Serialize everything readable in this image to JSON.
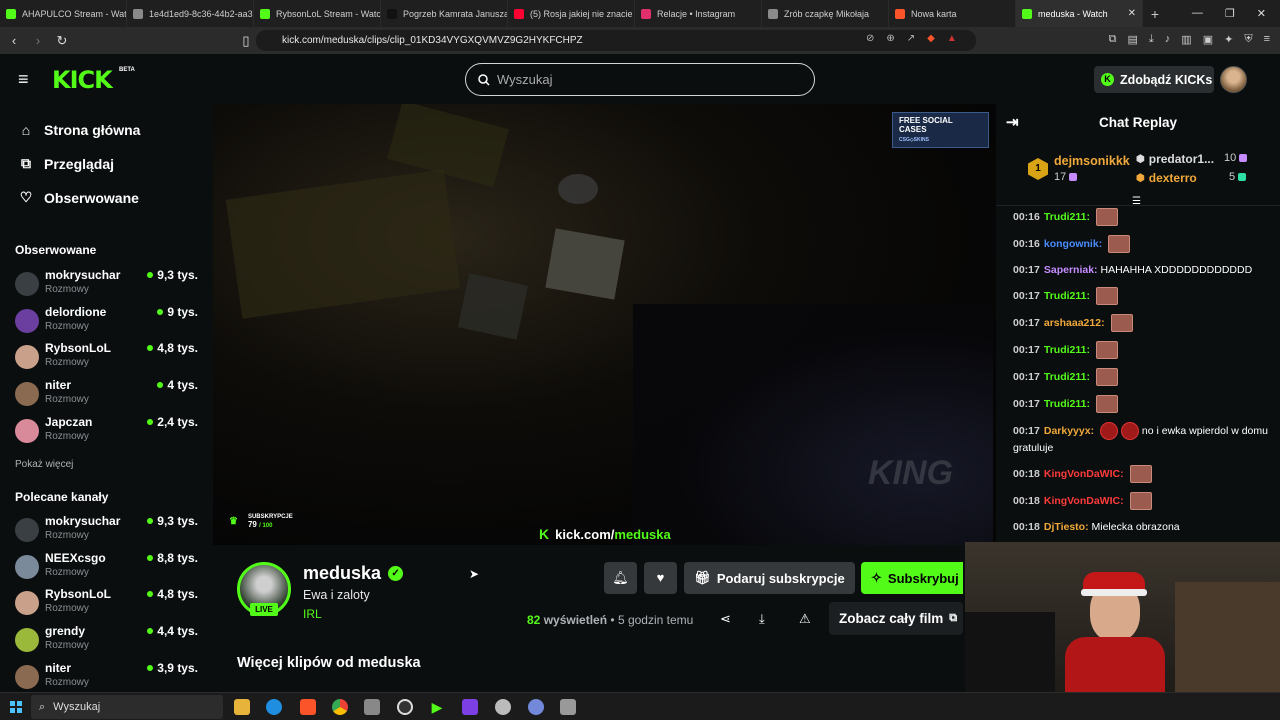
{
  "browser": {
    "tabs": [
      {
        "label": "AHAPULCO Stream - Watc",
        "color": "#53fc18"
      },
      {
        "label": "1e4d1ed9-8c36-44b2-aa3",
        "color": "#8a8a8a"
      },
      {
        "label": "RybsonLoL Stream - Watc",
        "color": "#53fc18"
      },
      {
        "label": "Pogrzeb Kamrata Janusza",
        "color": "#111111"
      },
      {
        "label": "(5) Rosja jakiej nie znacie",
        "color": "#ff0033"
      },
      {
        "label": "Relacje • Instagram",
        "color": "#e1306c"
      },
      {
        "label": "Zrób czapkę Mikołaja",
        "color": "#8a8a8a"
      },
      {
        "label": "Nowa karta",
        "color": "#fb542b"
      },
      {
        "label": "meduska - Watch",
        "color": "#53fc18",
        "active": true
      }
    ],
    "url": "kick.com/meduska/clips/clip_01KD34VYGXQVMVZ9G2HYKFCHPZ"
  },
  "header": {
    "logo": "KICK",
    "beta": "BETA",
    "search_placeholder": "Wyszukaj",
    "get_kicks": "Zdobądź KICKs"
  },
  "sidebar": {
    "nav": [
      {
        "label": "Strona główna",
        "icon": "home-icon"
      },
      {
        "label": "Przeglądaj",
        "icon": "browse-icon"
      },
      {
        "label": "Obserwowane",
        "icon": "heart-icon"
      }
    ],
    "followed_title": "Obserwowane",
    "followed": [
      {
        "name": "mokrysuchar",
        "category": "Rozmowy",
        "viewers": "9,3 tys.",
        "color": "#3a3f44"
      },
      {
        "name": "delordione",
        "category": "Rozmowy",
        "viewers": "9 tys.",
        "color": "#6b3fa0"
      },
      {
        "name": "RybsonLoL",
        "category": "Rozmowy",
        "viewers": "4,8 tys.",
        "color": "#c9a08a"
      },
      {
        "name": "niter",
        "category": "Rozmowy",
        "viewers": "4 tys.",
        "color": "#8a6a50"
      },
      {
        "name": "Japczan",
        "category": "Rozmowy",
        "viewers": "2,4 tys.",
        "color": "#d98a9a"
      }
    ],
    "show_more": "Pokaż więcej",
    "recommended_title": "Polecane kanały",
    "recommended": [
      {
        "name": "mokrysuchar",
        "category": "Rozmowy",
        "viewers": "9,3 tys.",
        "color": "#3a3f44"
      },
      {
        "name": "NEEXcsgo",
        "category": "Rozmowy",
        "viewers": "8,8 tys.",
        "color": "#7a8a9a"
      },
      {
        "name": "RybsonLoL",
        "category": "Rozmowy",
        "viewers": "4,8 tys.",
        "color": "#c9a08a"
      },
      {
        "name": "grendy",
        "category": "Rozmowy",
        "viewers": "4,4 tys.",
        "color": "#9ab83a"
      },
      {
        "name": "niter",
        "category": "Rozmowy",
        "viewers": "3,9 tys.",
        "color": "#8a6a50"
      }
    ]
  },
  "video": {
    "subs_label": "SUBSKRYPCJE",
    "subs_count": "79",
    "subs_goal": "/ 100",
    "watermark_prefix": "kick.com/",
    "watermark_channel": "meduska",
    "ad_text": "FREE SOCIAL CASES",
    "ad_sub": "CSG◇SKINS",
    "overlay_logo": "KING"
  },
  "clip": {
    "channel": "meduska",
    "title": "Ewa i zaloty",
    "category": "IRL",
    "live": "LIVE",
    "gift_label": "Podaruj subskrypcje",
    "subscribe_label": "Subskrybuj",
    "views_count": "82",
    "views_label": "wyświetleń",
    "time_ago": "• 5 godzin temu",
    "full_film": "Zobacz cały film",
    "more_clips": "Więcej klipów od meduska"
  },
  "chat": {
    "title": "Chat Replay",
    "leaderboard": [
      {
        "rank": "1",
        "name": "dejmsonikkk",
        "count": "17"
      },
      {
        "name": "predator1...",
        "count": "10"
      },
      {
        "name": "dexterro",
        "count": "5"
      }
    ],
    "messages": [
      {
        "time": "00:16",
        "user": "Trudi211:",
        "color": "#53fc18",
        "text": "",
        "emotes": 1
      },
      {
        "time": "00:16",
        "user": "kongownik:",
        "color": "#4a8cff",
        "text": "",
        "emotes": 1
      },
      {
        "time": "00:17",
        "user": "Saperniak:",
        "color": "#c58cff",
        "text": "HAHAHHA XDDDDDDDDDDDD",
        "emotes": 0
      },
      {
        "time": "00:17",
        "user": "Trudi211:",
        "color": "#53fc18",
        "text": "",
        "emotes": 1
      },
      {
        "time": "00:17",
        "user": "arshaaa212:",
        "color": "#f0a83a",
        "text": "",
        "emotes": 1
      },
      {
        "time": "00:17",
        "user": "Trudi211:",
        "color": "#53fc18",
        "text": "",
        "emotes": 1
      },
      {
        "time": "00:17",
        "user": "Trudi211:",
        "color": "#53fc18",
        "text": "",
        "emotes": 1
      },
      {
        "time": "00:17",
        "user": "Trudi211:",
        "color": "#53fc18",
        "text": "",
        "emotes": 1
      },
      {
        "time": "00:17",
        "user": "Darkyyyx:",
        "color": "#f0a83a",
        "text": "no i ewka wpierdol w domu gratuluje",
        "emotes": 2
      },
      {
        "time": "00:18",
        "user": "KingVonDaWIC:",
        "color": "#ff3b3b",
        "text": "",
        "emotes": 1
      },
      {
        "time": "00:18",
        "user": "KingVonDaWIC:",
        "color": "#ff3b3b",
        "text": "",
        "emotes": 1
      },
      {
        "time": "00:18",
        "user": "DjTiesto:",
        "color": "#f0a83a",
        "text": "Mielecka obrazona",
        "emotes": 0
      }
    ]
  },
  "taskbar": {
    "search": "Wyszukaj"
  }
}
